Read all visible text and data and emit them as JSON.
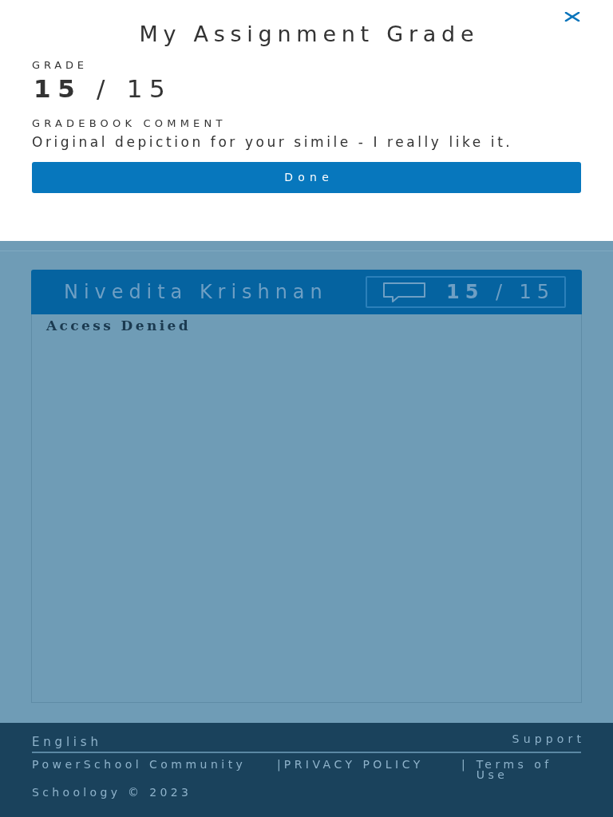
{
  "modal": {
    "title": "My Assignment Grade",
    "grade_label": "GRADE",
    "grade": {
      "score": "15",
      "separator": "/",
      "max": "15"
    },
    "comment_label": "GRADEBOOK COMMENT",
    "comment": "Original depiction for your simile - I really like it.",
    "done_button": "Done"
  },
  "card": {
    "student_name": "Nivedita Krishnan",
    "grade": {
      "score": "15",
      "separator": "/",
      "max": "15"
    },
    "content": "Access Denied"
  },
  "footer": {
    "language": "English",
    "support": "Support",
    "links": [
      {
        "label": "PowerSchool Community"
      },
      {
        "separator": "|",
        "label": "PRIVACY POLICY"
      },
      {
        "separator": "|",
        "label": "Terms of Use"
      }
    ],
    "copyright": "Schoology © 2023"
  }
}
